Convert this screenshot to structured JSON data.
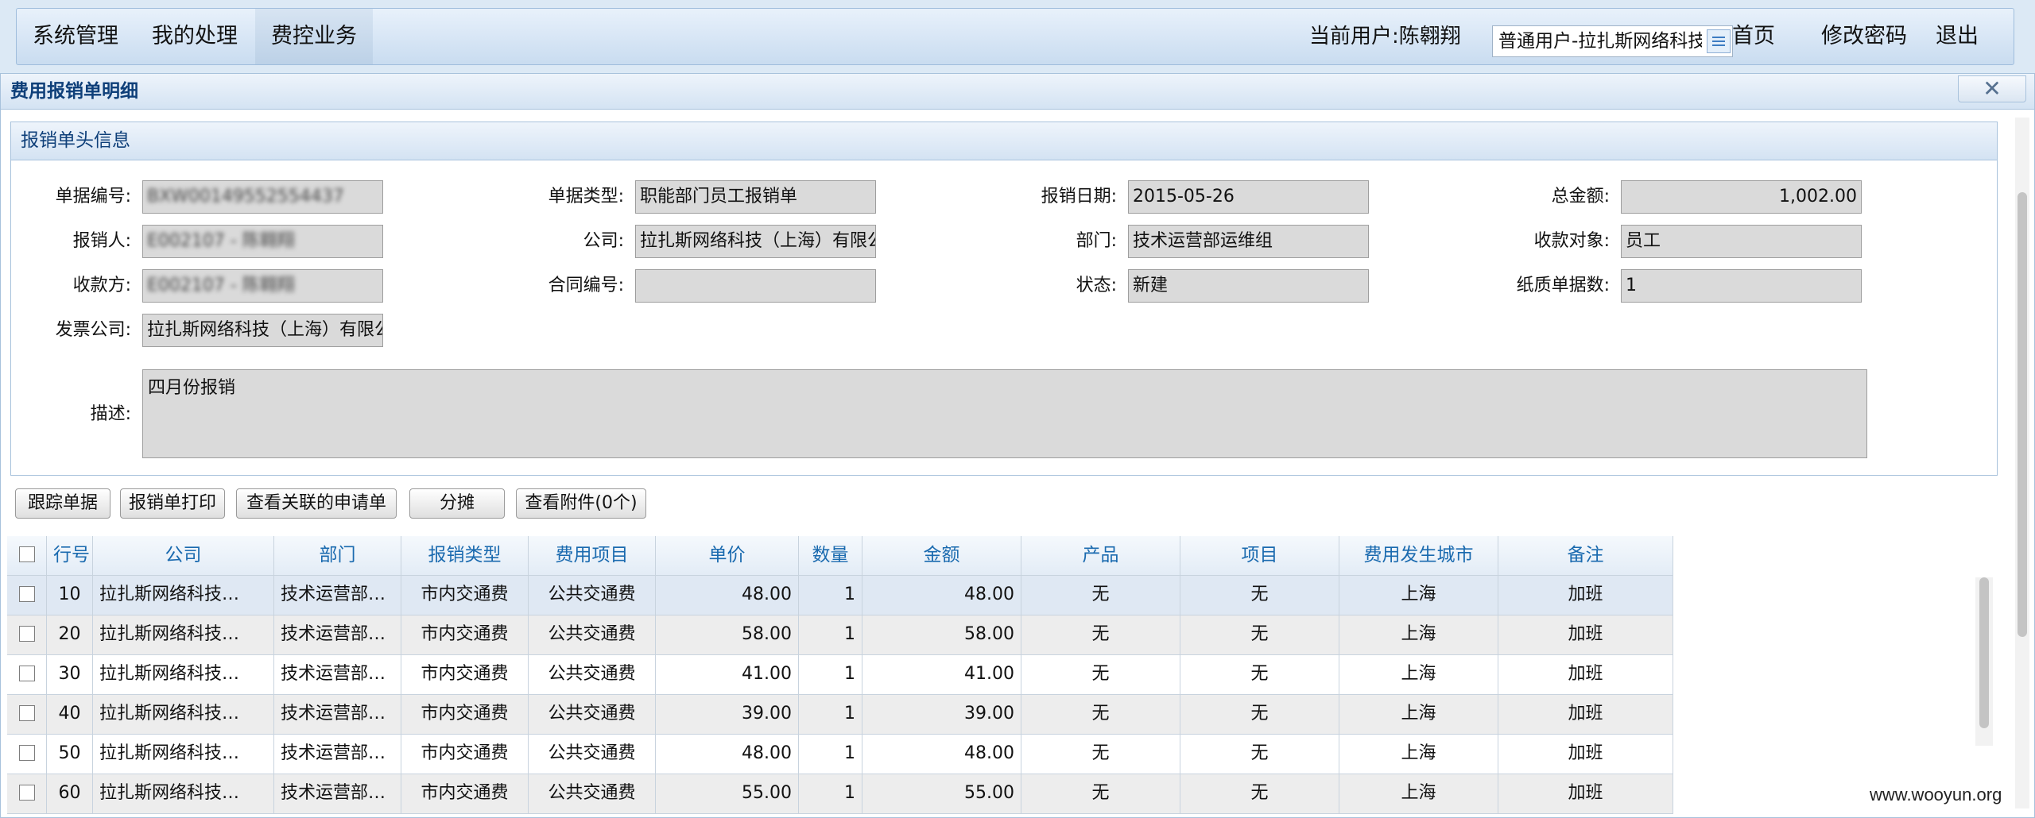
{
  "nav": {
    "menu": [
      "系统管理",
      "我的处理",
      "费控业务"
    ],
    "active_menu": "费控业务",
    "current_user_label": "当前用户:陈翱翔",
    "user_role_select": "普通用户-拉扎斯网络科技",
    "links": {
      "home": "首页",
      "change_password": "修改密码",
      "logout": "退出"
    }
  },
  "window": {
    "title": "费用报销单明细",
    "close_glyph": "✕"
  },
  "header": {
    "panel_title": "报销单头信息",
    "fields": {
      "doc_no": {
        "label": "单据编号:",
        "value": "BXW00149552554437"
      },
      "doc_type": {
        "label": "单据类型:",
        "value": "职能部门员工报销单"
      },
      "claim_date": {
        "label": "报销日期:",
        "value": "2015-05-26"
      },
      "total_amount": {
        "label": "总金额:",
        "value": "1,002.00"
      },
      "claimant": {
        "label": "报销人:",
        "value": "E002107 - 陈翱翔"
      },
      "company": {
        "label": "公司:",
        "value": "拉扎斯网络科技（上海）有限公司"
      },
      "department": {
        "label": "部门:",
        "value": "技术运营部运维组"
      },
      "payee_type": {
        "label": "收款对象:",
        "value": "员工"
      },
      "payee": {
        "label": "收款方:",
        "value": "E002107 - 陈翱翔"
      },
      "contract_no": {
        "label": "合同编号:",
        "value": ""
      },
      "status": {
        "label": "状态:",
        "value": "新建"
      },
      "paper_docs": {
        "label": "纸质单据数:",
        "value": "1"
      },
      "invoice_company": {
        "label": "发票公司:",
        "value": "拉扎斯网络科技（上海）有限公司"
      },
      "description": {
        "label": "描述:",
        "value": "四月份报销"
      }
    }
  },
  "toolbar": {
    "track": "跟踪单据",
    "print": "报销单打印",
    "view_related": "查看关联的申请单",
    "allocate": "分摊",
    "attachments": "查看附件(0个)"
  },
  "grid": {
    "columns": [
      "行号",
      "公司",
      "部门",
      "报销类型",
      "费用项目",
      "单价",
      "数量",
      "金额",
      "产品",
      "项目",
      "费用发生城市",
      "备注"
    ],
    "rows": [
      [
        "10",
        "拉扎斯网络科技…",
        "技术运营部…",
        "市内交通费",
        "公共交通费",
        "48.00",
        "1",
        "48.00",
        "无",
        "无",
        "上海",
        "加班"
      ],
      [
        "20",
        "拉扎斯网络科技…",
        "技术运营部…",
        "市内交通费",
        "公共交通费",
        "58.00",
        "1",
        "58.00",
        "无",
        "无",
        "上海",
        "加班"
      ],
      [
        "30",
        "拉扎斯网络科技…",
        "技术运营部…",
        "市内交通费",
        "公共交通费",
        "41.00",
        "1",
        "41.00",
        "无",
        "无",
        "上海",
        "加班"
      ],
      [
        "40",
        "拉扎斯网络科技…",
        "技术运营部…",
        "市内交通费",
        "公共交通费",
        "39.00",
        "1",
        "39.00",
        "无",
        "无",
        "上海",
        "加班"
      ],
      [
        "50",
        "拉扎斯网络科技…",
        "技术运营部…",
        "市内交通费",
        "公共交通费",
        "48.00",
        "1",
        "48.00",
        "无",
        "无",
        "上海",
        "加班"
      ],
      [
        "60",
        "拉扎斯网络科技…",
        "技术运营部…",
        "市内交通费",
        "公共交通费",
        "55.00",
        "1",
        "55.00",
        "无",
        "无",
        "上海",
        "加班"
      ]
    ]
  },
  "watermark": "www.wooyun.org"
}
